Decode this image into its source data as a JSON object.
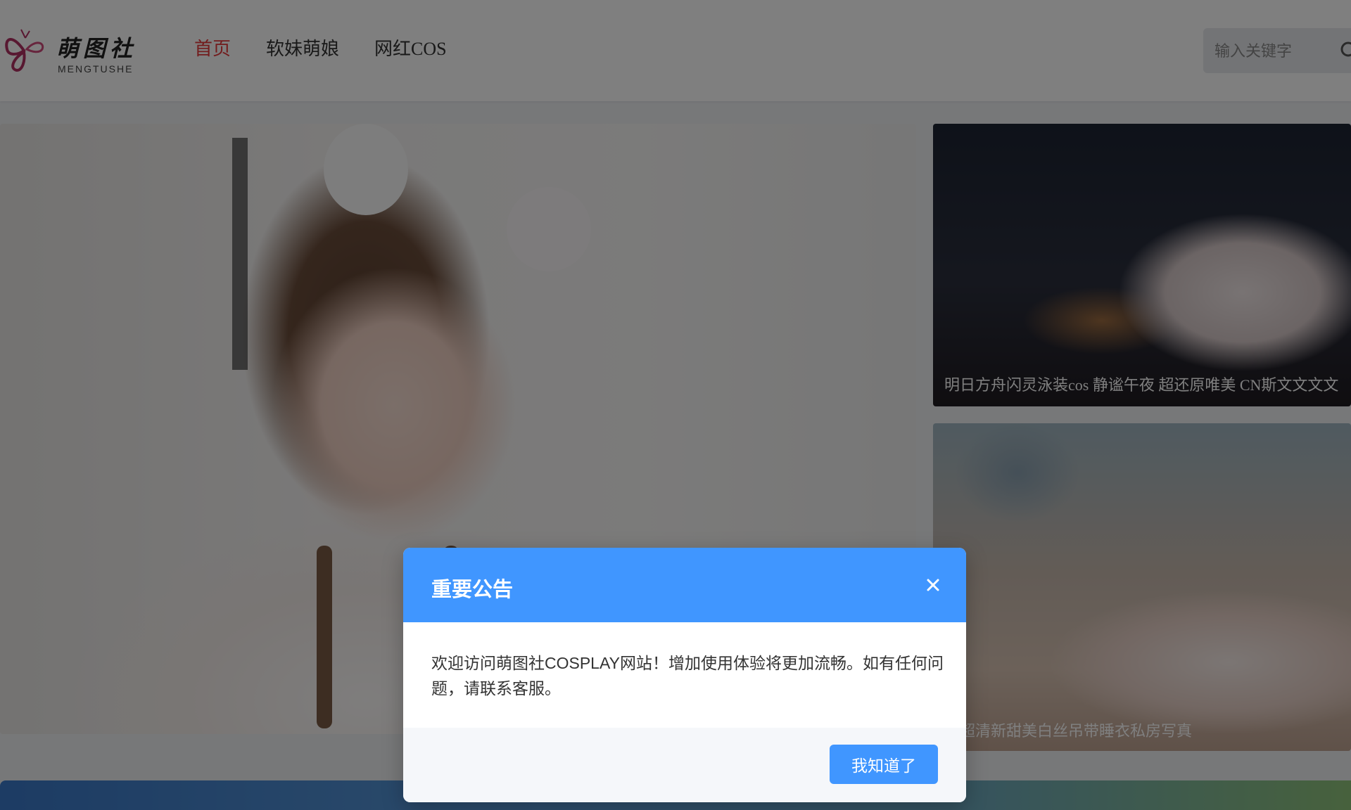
{
  "header": {
    "logo_title": "萌图社",
    "logo_subtitle": "MENGTUSHE",
    "nav": [
      {
        "label": "首页",
        "active": true
      },
      {
        "label": "软妹萌娘",
        "active": false
      },
      {
        "label": "网红COS",
        "active": false
      }
    ],
    "search": {
      "placeholder": "输入关键字",
      "icon": "search-icon"
    }
  },
  "cards": [
    {
      "caption": "明日方舟闪灵泳装cos 静谧午夜 超还原唯美 CN斯文文文文"
    },
    {
      "caption": "棉棉的超清新甜美白丝吊带睡衣私房写真"
    }
  ],
  "modal": {
    "title": "重要公告",
    "close_icon": "close-icon",
    "body": "欢迎访问萌图社COSPLAY网站！增加使用体验将更加流畅。如有任何问题，请联系客服。",
    "confirm_label": "我知道了",
    "header_color": "#4096ff"
  },
  "colors": {
    "accent": "#4096ff",
    "active_nav": "#e5383b"
  }
}
